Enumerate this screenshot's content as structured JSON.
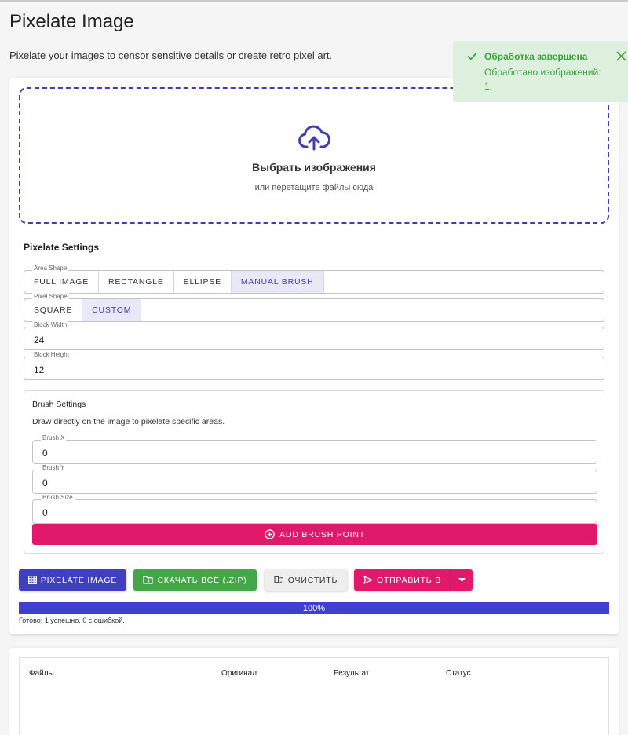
{
  "page": {
    "title": "Pixelate Image",
    "subtitle": "Pixelate your images to censor sensitive details or create retro pixel art."
  },
  "dropzone": {
    "icon": "cloud-upload-icon",
    "title": "Выбрать изображения",
    "hint": "или перетащите файлы сюда"
  },
  "settings": {
    "title": "Pixelate Settings",
    "area_shape": {
      "legend": "Area Shape",
      "options": [
        "Full Image",
        "Rectangle",
        "Ellipse",
        "Manual Brush"
      ],
      "selected": "Manual Brush"
    },
    "pixel_shape": {
      "legend": "Pixel Shape",
      "options": [
        "Square",
        "Custom"
      ],
      "selected": "Custom"
    },
    "block_width": {
      "legend": "Block Width",
      "value": "24"
    },
    "block_height": {
      "legend": "Block Height",
      "value": "12"
    }
  },
  "brush": {
    "title": "Brush Settings",
    "description": "Draw directly on the image to pixelate specific areas.",
    "brush_x": {
      "legend": "Brush X",
      "value": "0"
    },
    "brush_y": {
      "legend": "Brush Y",
      "value": "0"
    },
    "brush_size": {
      "legend": "Brush Size",
      "value": "0"
    },
    "add_label": "ADD BRUSH POINT"
  },
  "actions": {
    "pixelate_label": "PIXELATE IMAGE",
    "zip_label": "СКАЧАТЬ ВСЁ (.ZIP)",
    "clear_label": "ОЧИСТИТЬ",
    "send_label": "ОТПРАВИТЬ В"
  },
  "progress": {
    "percent": 100,
    "label": "100%",
    "status": "Готово: 1 успешно, 0 с ошибкой."
  },
  "table": {
    "columns": [
      "Файлы",
      "Оригинал",
      "Результат",
      "Статус"
    ]
  },
  "toast": {
    "title": "Обработка завершена",
    "body": "Обработано изображений: 1."
  },
  "colors": {
    "primary": "#3f3fbf",
    "accent_pink": "#e0196a",
    "success_green": "#43a747",
    "toast_bg": "#ddf0de"
  }
}
